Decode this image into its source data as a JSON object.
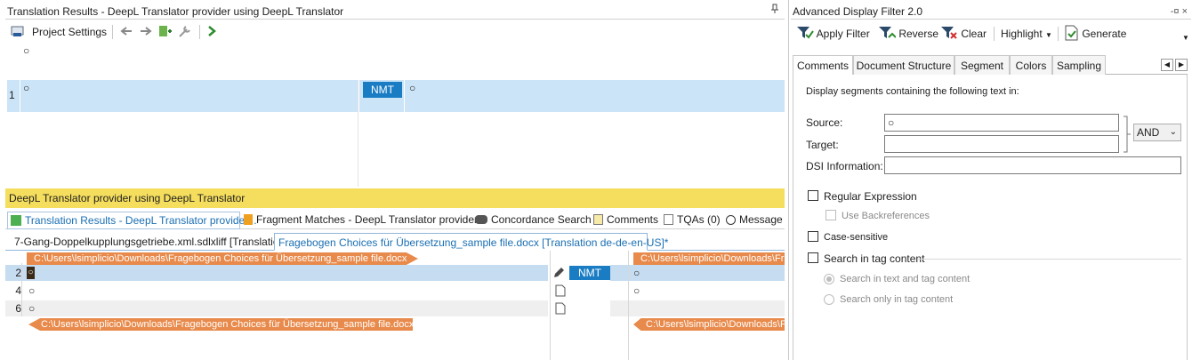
{
  "left": {
    "title": "Translation Results - DeepL Translator provider using DeepL Translator",
    "toolbar": {
      "project_settings": "Project Settings"
    },
    "segment_area": {
      "top_source": "○",
      "row_number": "1",
      "source": "○",
      "badge": "NMT",
      "target": "○"
    },
    "provider_bar": "DeepL Translator provider using DeepL Translator",
    "tool_tabs": [
      "Translation Results - DeepL Translator provider...",
      "Fragment Matches - DeepL Translator provider...",
      "Concordance Search",
      "Comments",
      "TQAs (0)",
      "Message"
    ],
    "doc_tabs": [
      "7-Gang-Doppelkupplungsgetriebe.xml.sdlxliff [Translation]",
      "Fragebogen Choices für Übersetzung_sample file.docx [Translation de-de-en-US]*"
    ],
    "editor": {
      "path_start": "C:\\Users\\lsimplicio\\Downloads\\Fragebogen Choices für Übersetzung_sample file.docx",
      "path_end": "C:\\Users\\lsimplicio\\Downloads\\Fragebogen Choices für Übersetzung_sample file.docx",
      "path_target_start": "C:\\Users\\lsimplicio\\Downloads\\Fr",
      "path_target_end": "C:\\Users\\lsimplicio\\Downloads\\Fr",
      "rows": [
        {
          "num": "2",
          "source": "○",
          "status": "NMT",
          "target": "○"
        },
        {
          "num": "4",
          "source": "○",
          "status": "",
          "target": "○"
        },
        {
          "num": "6",
          "source": "○",
          "status": "",
          "target": ""
        }
      ]
    }
  },
  "right": {
    "title": "Advanced Display Filter 2.0",
    "toolbar": {
      "apply": "Apply Filter",
      "reverse": "Reverse",
      "clear": "Clear",
      "highlight": "Highlight",
      "generate": "Generate"
    },
    "tabs": [
      "Comments",
      "Document Structure",
      "Segment",
      "Colors",
      "Sampling"
    ],
    "body": {
      "heading": "Display segments containing the following text in:",
      "source_label": "Source:",
      "source_value": "○",
      "target_label": "Target:",
      "target_value": "",
      "operator": "AND",
      "dsi_label": "DSI Information:",
      "dsi_value": "",
      "regex": "Regular Expression",
      "backrefs": "Use Backreferences",
      "case": "Case-sensitive",
      "tag": "Search in tag content",
      "radio1": "Search in text and tag content",
      "radio2": "Search only in tag content"
    }
  }
}
